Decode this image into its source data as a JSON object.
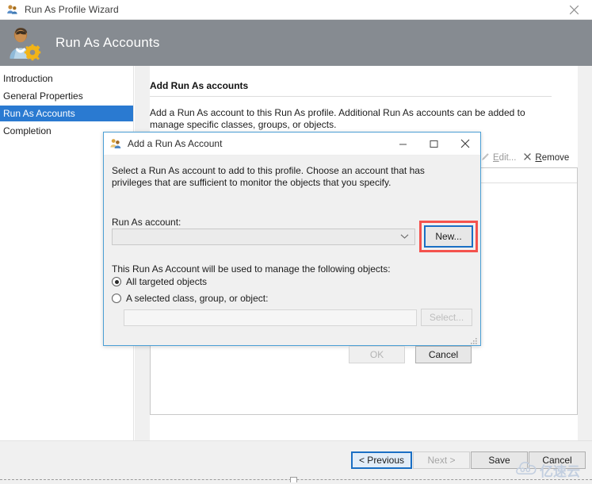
{
  "window": {
    "title": "Run As Profile Wizard",
    "title_icon": "users-icon",
    "close_icon": "close-icon"
  },
  "banner": {
    "title": "Run As Accounts",
    "icon": "user-gear-icon",
    "background": "#868b91"
  },
  "sidebar": {
    "items": [
      {
        "label": "Introduction",
        "selected": false
      },
      {
        "label": "General Properties",
        "selected": false
      },
      {
        "label": "Run As Accounts",
        "selected": true
      },
      {
        "label": "Completion",
        "selected": false
      }
    ],
    "selected_color": "#2a7ad1"
  },
  "main": {
    "heading": "Add Run As accounts",
    "description": "Add a Run As account to this Run As profile.  Additional Run As accounts can be added to manage specific classes, groups, or objects.",
    "toolbar": [
      {
        "label_prefix": "",
        "accel": "E",
        "label_rest": "dit...",
        "icon": "pencil-icon",
        "enabled": false
      },
      {
        "label_prefix": "",
        "accel": "R",
        "label_rest": "emove",
        "icon": "x-mark-icon",
        "enabled": true
      }
    ]
  },
  "dialog": {
    "title": "Add a Run As Account",
    "icon": "run-as-account-icon",
    "minimize_icon": "minimize-icon",
    "maximize_icon": "maximize-icon",
    "close_icon": "close-icon",
    "description": "Select a Run As account to add to this profile.  Choose an account that has privileges that are sufficient to monitor the objects that you specify.",
    "runas_label": "Run As account:",
    "runas_value": "",
    "dropdown_icon": "chevron-down-icon",
    "new_button": "New...",
    "manage_label": "This Run As Account will be used to manage the following objects:",
    "radios": [
      {
        "label": "All targeted objects",
        "checked": true
      },
      {
        "label": "A selected class, group, or object:",
        "checked": false
      }
    ],
    "selected_object_value": "",
    "select_button": "Select...",
    "ok_button": "OK",
    "cancel_button": "Cancel",
    "highlight_color": "#f4524d",
    "focus_color": "#1a6fc4"
  },
  "footer": {
    "buttons": [
      {
        "label": "< Previous",
        "state": "focused"
      },
      {
        "label": "Next >",
        "state": "disabled"
      },
      {
        "label": "Save",
        "state": "normal"
      },
      {
        "label": "Cancel",
        "state": "normal"
      }
    ]
  },
  "watermark": {
    "text": "亿速云",
    "icon": "cloud-icon",
    "color": "#c3cfe0"
  }
}
